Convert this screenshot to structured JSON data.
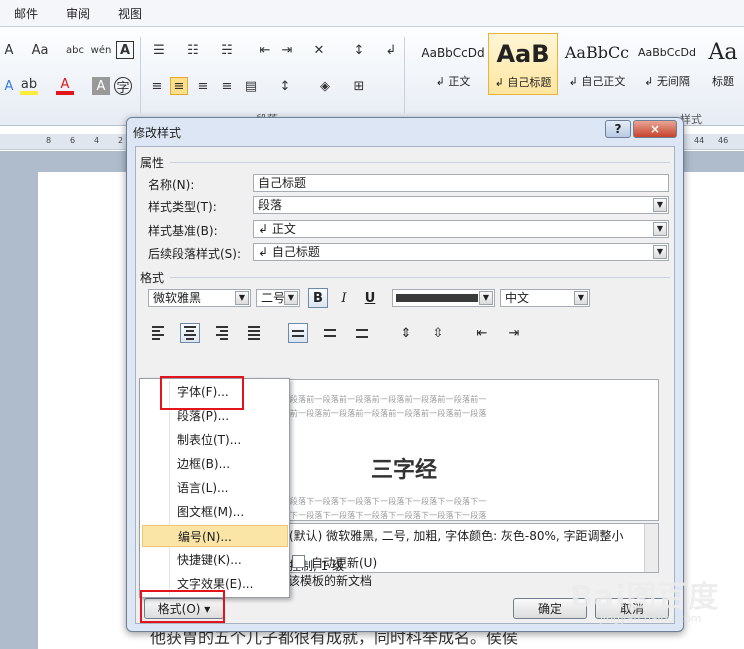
{
  "ribbon": {
    "tabs": [
      "邮件",
      "审阅",
      "视图"
    ],
    "font_tools": [
      "Aa",
      "abc",
      "wén",
      "A"
    ],
    "group_paragraph": "段落",
    "group_styles": "样式",
    "styles": [
      {
        "preview": "AaBbCcDd",
        "name": "↲ 正文"
      },
      {
        "preview": "AaB",
        "name": "↲ 自己标题"
      },
      {
        "preview": "AaBbCc",
        "name": "↲ 自己正文"
      },
      {
        "preview": "AaBbCcDd",
        "name": "↲ 无间隔"
      },
      {
        "preview": "Aa",
        "name": "标题"
      }
    ],
    "colors": {
      "accent": "#e8b33f",
      "highlight": "#ffe08a"
    }
  },
  "ruler": {
    "numbers": [
      "8",
      "6",
      "4",
      "2",
      "44",
      "46"
    ]
  },
  "document": {
    "text": "他获胃的五个儿子都很有成就，同时科举成名。侯侯"
  },
  "dialog": {
    "title": "修改样式",
    "help": "?",
    "close": "×",
    "properties_header": "属性",
    "name_label": "名称(N):",
    "name_value": "自己标题",
    "type_label": "样式类型(T):",
    "type_value": "段落",
    "base_label": "样式基准(B):",
    "base_value": "↲ 正文",
    "next_label": "后续段落样式(S):",
    "next_value": "↲ 自己标题",
    "format_header": "格式",
    "font_name": "微软雅黑",
    "font_size": "二号",
    "bold": "B",
    "italic": "I",
    "underline": "U",
    "script": "中文",
    "preview": {
      "prev_lines": [
        "前一段落前一段落前一段落前一段落前一段落前一段落前一段落前一段落前一段落前一",
        "段落前一段落前一段落前一段落前一段落前一段落前一段落前一段落前一段落前一段落",
        "前一段落前一段落"
      ],
      "title": "三字经",
      "next_lines": [
        "下一段落下一段落下一段落下一段落下一段落下一段落下一段落下一段落下一段落下一",
        "段落下一段落下一段落下一段落下一段落下一段落下一段落下一段落下一段落下一段落"
      ]
    },
    "description_line1": "(默认) 微软雅黑, 二号, 加粗, 字体颜色: 灰色-80%, 字距调整小",
    "description_line2": "控制, 1 级",
    "auto_update": "自动更新(U)",
    "template_text": "该模板的新文档",
    "format_button": "格式(O) ▾",
    "ok": "确定",
    "cancel": "取消"
  },
  "menu": {
    "items": [
      "字体(F)...",
      "段落(P)...",
      "制表位(T)...",
      "边框(B)...",
      "语言(L)...",
      "图文框(M)...",
      "编号(N)...",
      "快捷键(K)...",
      "文字效果(E)..."
    ],
    "highlighted_index": 6
  },
  "watermark": {
    "logo": "Bai图百度",
    "sub": "jingyan.baidu.com"
  }
}
